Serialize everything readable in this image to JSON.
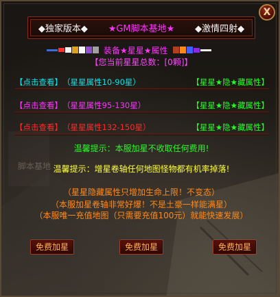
{
  "banner": {
    "item1": "◆独家版本◆",
    "item2": "★GM脚本基地★",
    "item3": "◆激情四射◆"
  },
  "equip_title": "装备★星星★属性",
  "equip_swatch_colors": [
    "#3a6ae0",
    "#ff3030",
    "#f2f2f2",
    "#e0a020",
    "#ffffff",
    "#9050d0",
    "#a0a0a0",
    "#b04020",
    "#ff8a1a",
    "#4060ff",
    "#8a2ae0",
    "#f2f2f2"
  ],
  "total_stars_line": "【您当前星星总数：[0颗]】",
  "star_rows": [
    {
      "link": "【点击查看】",
      "range": "（星星属性10-90星）",
      "hidden": "【星星★隐★藏属性】",
      "color": "cyan"
    },
    {
      "link": "【点击查看】",
      "range": "（星星属性95-130星）",
      "hidden": "【星星★隐★藏属性】",
      "color": "magenta"
    },
    {
      "link": "【点击查看】",
      "range": "（星星属性132-150星）",
      "hidden": "【星星★隐★藏属性】",
      "color": "red"
    }
  ],
  "tips": {
    "tip1": "温馨提示：本服加星不收取任何费用!",
    "tip2": "温馨提示：增星卷轴任何地图怪物都有机率掉落!"
  },
  "faint_text": "脚本基地",
  "info_lines": [
    "（星星隐藏属性只增加生命上限！不变态）",
    "（本服加星卷轴非常好爆！不是土豪一样能满星）",
    "（本服唯一充值地图（只需要充值100元）就能快速发展）"
  ],
  "buttons": {
    "free_star_1": "免费加星",
    "free_star_2": "免费加星",
    "free_star_3": "免费加星"
  },
  "close_label": "X"
}
